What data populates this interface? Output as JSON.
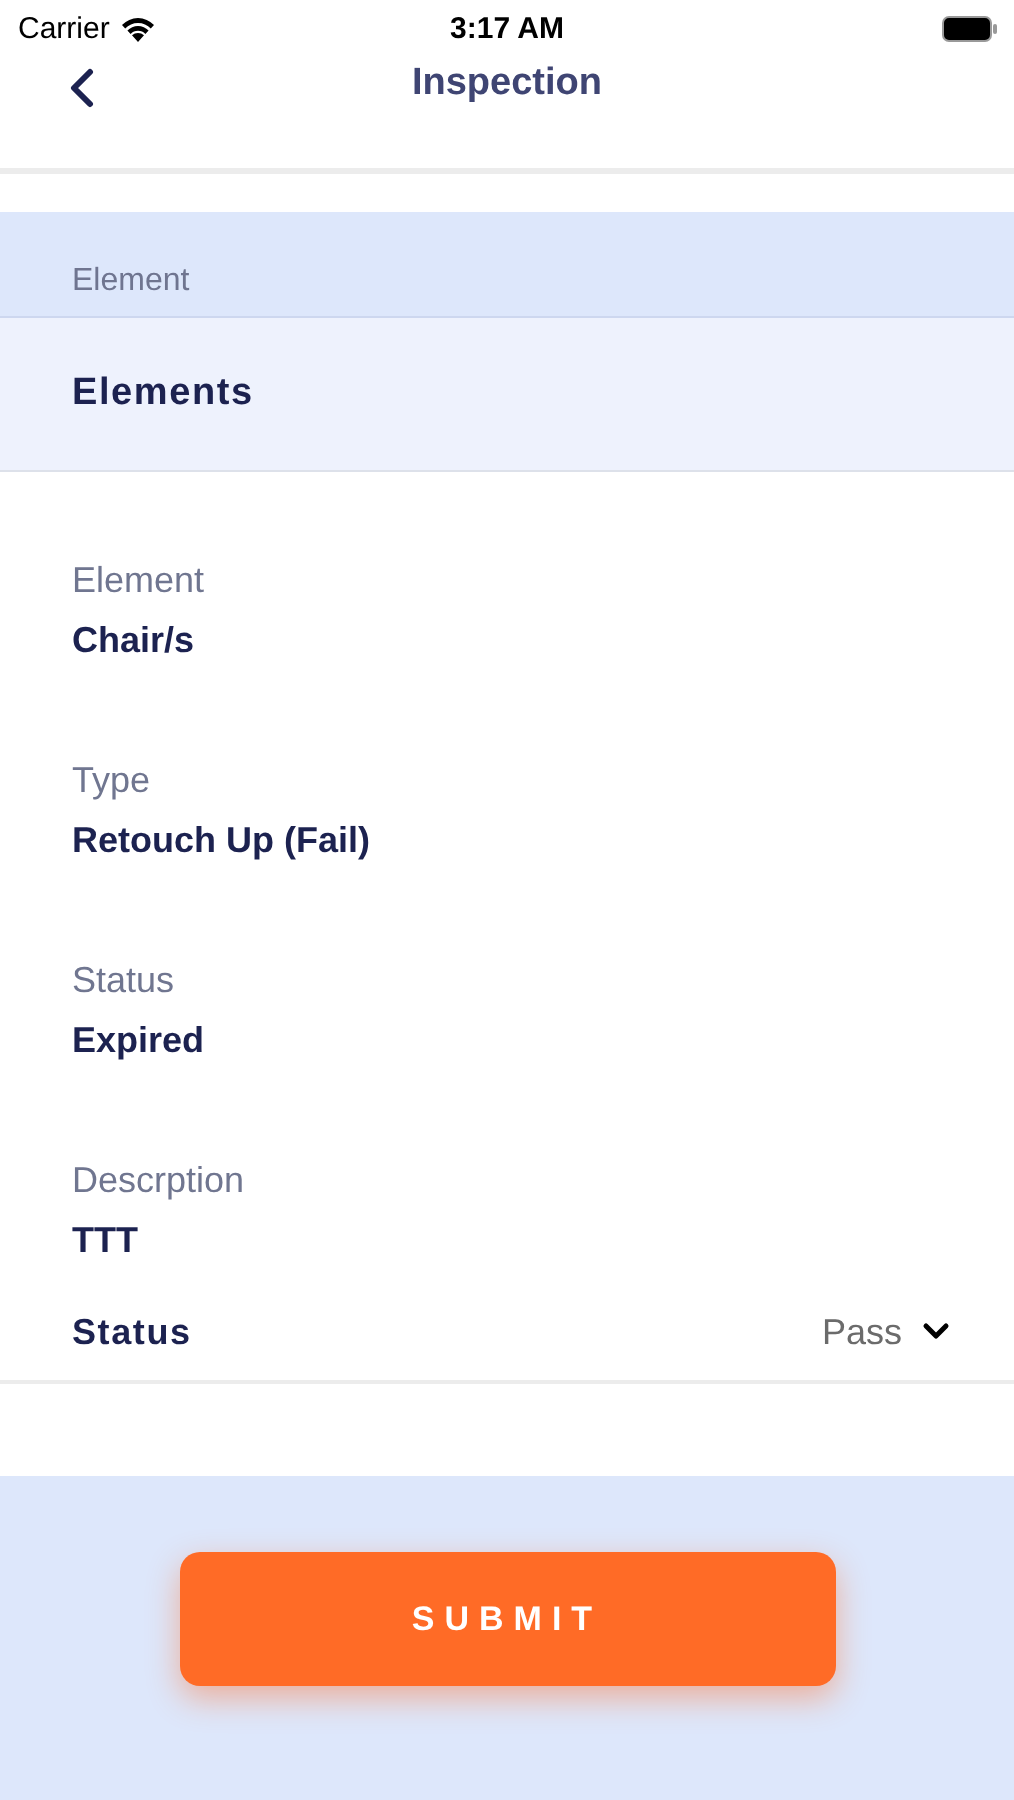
{
  "status_bar": {
    "carrier": "Carrier",
    "time": "3:17 AM"
  },
  "nav": {
    "title": "Inspection"
  },
  "section": {
    "header": "Element",
    "item": "Elements"
  },
  "fields": [
    {
      "label": "Element",
      "value": "Chair/s"
    },
    {
      "label": "Type",
      "value": "Retouch Up (Fail)"
    },
    {
      "label": "Status",
      "value": "Expired"
    },
    {
      "label": "Descrption",
      "value": "TTT"
    }
  ],
  "status_picker": {
    "label": "Status",
    "value": "Pass"
  },
  "submit": "SUBMIT"
}
